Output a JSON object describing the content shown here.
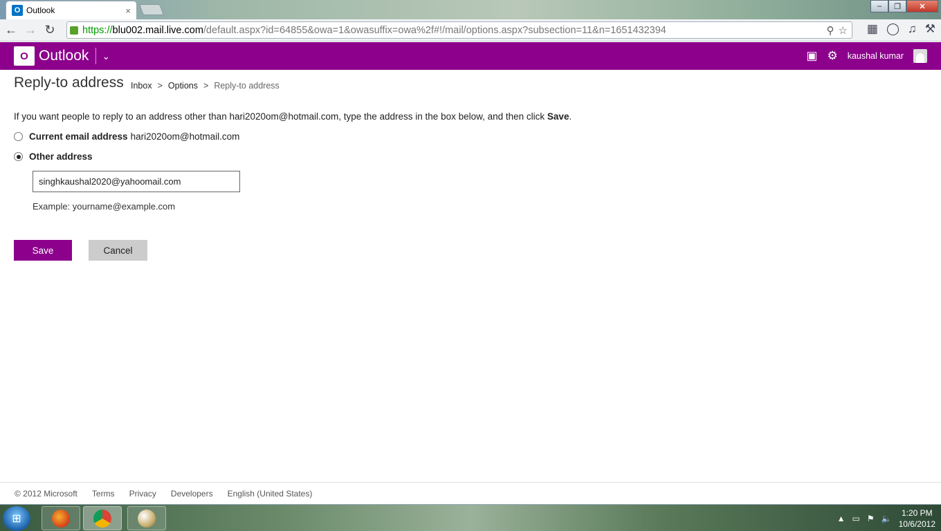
{
  "browser": {
    "tab_title": "Outlook",
    "tab_favicon": "O",
    "tab_close": "×",
    "url_https": "https://",
    "url_host": "blu002.mail.live.com",
    "url_rest": "/default.aspx?id=64855&owa=1&owasuffix=owa%2f#!/mail/options.aspx?subsection=11&n=1651432394",
    "window_controls": {
      "minimize": "–",
      "maximize": "❐",
      "close": "✕"
    }
  },
  "header": {
    "logo_letter": "O",
    "app_name": "Outlook",
    "user_name": "kaushal kumar",
    "colors": {
      "brand": "#8c008c"
    }
  },
  "page": {
    "title": "Reply-to address",
    "breadcrumb": [
      {
        "label": "Inbox"
      },
      {
        "label": "Options"
      },
      {
        "label": "Reply-to address"
      }
    ],
    "breadcrumb_sep": ">",
    "instructions_pre": "If you want people to reply to an address other than hari2020om@hotmail.com, type the address in the box below, and then click ",
    "instructions_bold": "Save",
    "instructions_post": ".",
    "current_label": "Current email address",
    "current_value": "hari2020om@hotmail.com",
    "other_label": "Other address",
    "other_value": "singhkaushal2020@yahoomail.com",
    "example": "Example: yourname@example.com",
    "save_label": "Save",
    "cancel_label": "Cancel"
  },
  "footer": {
    "copyright": "© 2012 Microsoft",
    "links": [
      "Terms",
      "Privacy",
      "Developers",
      "English (United States)"
    ]
  },
  "taskbar": {
    "time": "1:20 PM",
    "date": "10/6/2012"
  }
}
